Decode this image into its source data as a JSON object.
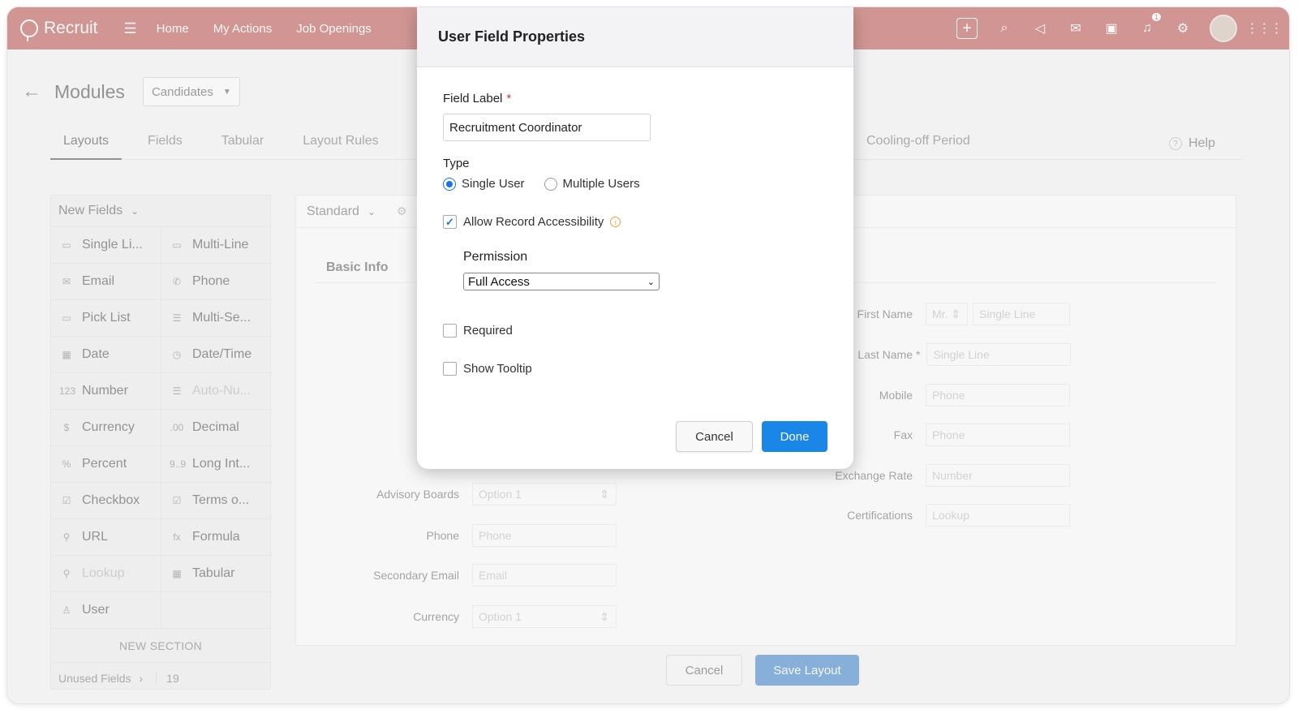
{
  "app": {
    "brand": "Recruit"
  },
  "nav": {
    "links": [
      "Home",
      "My Actions",
      "Job Openings"
    ],
    "notification_count": "1"
  },
  "page": {
    "title": "Modules",
    "module_select": "Candidates",
    "tabs": [
      "Layouts",
      "Fields",
      "Tabular",
      "Layout Rules"
    ],
    "tab_right": "Cooling-off Period",
    "help": "Help"
  },
  "palette": {
    "header": "New Fields",
    "items": [
      {
        "icon": "▭",
        "label": "Single Li..."
      },
      {
        "icon": "▭",
        "label": "Multi-Line"
      },
      {
        "icon": "✉",
        "label": "Email"
      },
      {
        "icon": "✆",
        "label": "Phone"
      },
      {
        "icon": "▭",
        "label": "Pick List"
      },
      {
        "icon": "☰",
        "label": "Multi-Se..."
      },
      {
        "icon": "▦",
        "label": "Date"
      },
      {
        "icon": "◷",
        "label": "Date/Time"
      },
      {
        "icon": "123",
        "label": "Number"
      },
      {
        "icon": "☰",
        "label": "Auto-Nu..."
      },
      {
        "icon": "$",
        "label": "Currency"
      },
      {
        "icon": ".00",
        "label": "Decimal"
      },
      {
        "icon": "%",
        "label": "Percent"
      },
      {
        "icon": "9..9",
        "label": "Long Int..."
      },
      {
        "icon": "☑",
        "label": "Checkbox"
      },
      {
        "icon": "☑",
        "label": "Terms o..."
      },
      {
        "icon": "⚲",
        "label": "URL"
      },
      {
        "icon": "fx",
        "label": "Formula"
      },
      {
        "icon": "⚲",
        "label": "Lookup"
      },
      {
        "icon": "▦",
        "label": "Tabular"
      },
      {
        "icon": "♙",
        "label": "User"
      },
      {
        "icon": "",
        "label": ""
      }
    ],
    "new_section": "NEW SECTION",
    "unused_label": "Unused Fields",
    "unused_count": "19"
  },
  "canvas": {
    "header": "Standard",
    "section": "Basic Info",
    "left_fields": [
      {
        "label": "Advisory Boards",
        "placeholder": "Option 1"
      },
      {
        "label": "Phone",
        "placeholder": "Phone"
      },
      {
        "label": "Secondary Email",
        "placeholder": "Email"
      },
      {
        "label": "Currency",
        "placeholder": "Option 1"
      }
    ],
    "right_fields": [
      {
        "label": "First Name",
        "placeholder": "Single Line",
        "prefix": "Mr."
      },
      {
        "label": "Last Name",
        "placeholder": "Single Line"
      },
      {
        "label": "Mobile",
        "placeholder": "Phone"
      },
      {
        "label": "Fax",
        "placeholder": "Phone"
      },
      {
        "label": "Exchange Rate",
        "placeholder": "Number"
      },
      {
        "label": "Certifications",
        "placeholder": "Lookup"
      }
    ],
    "cancel": "Cancel",
    "save": "Save Layout"
  },
  "modal": {
    "title": "User Field Properties",
    "field_label": "Field Label",
    "field_value": "Recruitment Coordinator",
    "type_label": "Type",
    "type_options": [
      "Single User",
      "Multiple Users"
    ],
    "type_selected": "Single User",
    "allow_access": "Allow Record Accessibility",
    "allow_access_checked": true,
    "permission_label": "Permission",
    "permission_value": "Full Access",
    "required": "Required",
    "show_tooltip": "Show Tooltip",
    "cancel": "Cancel",
    "done": "Done"
  }
}
